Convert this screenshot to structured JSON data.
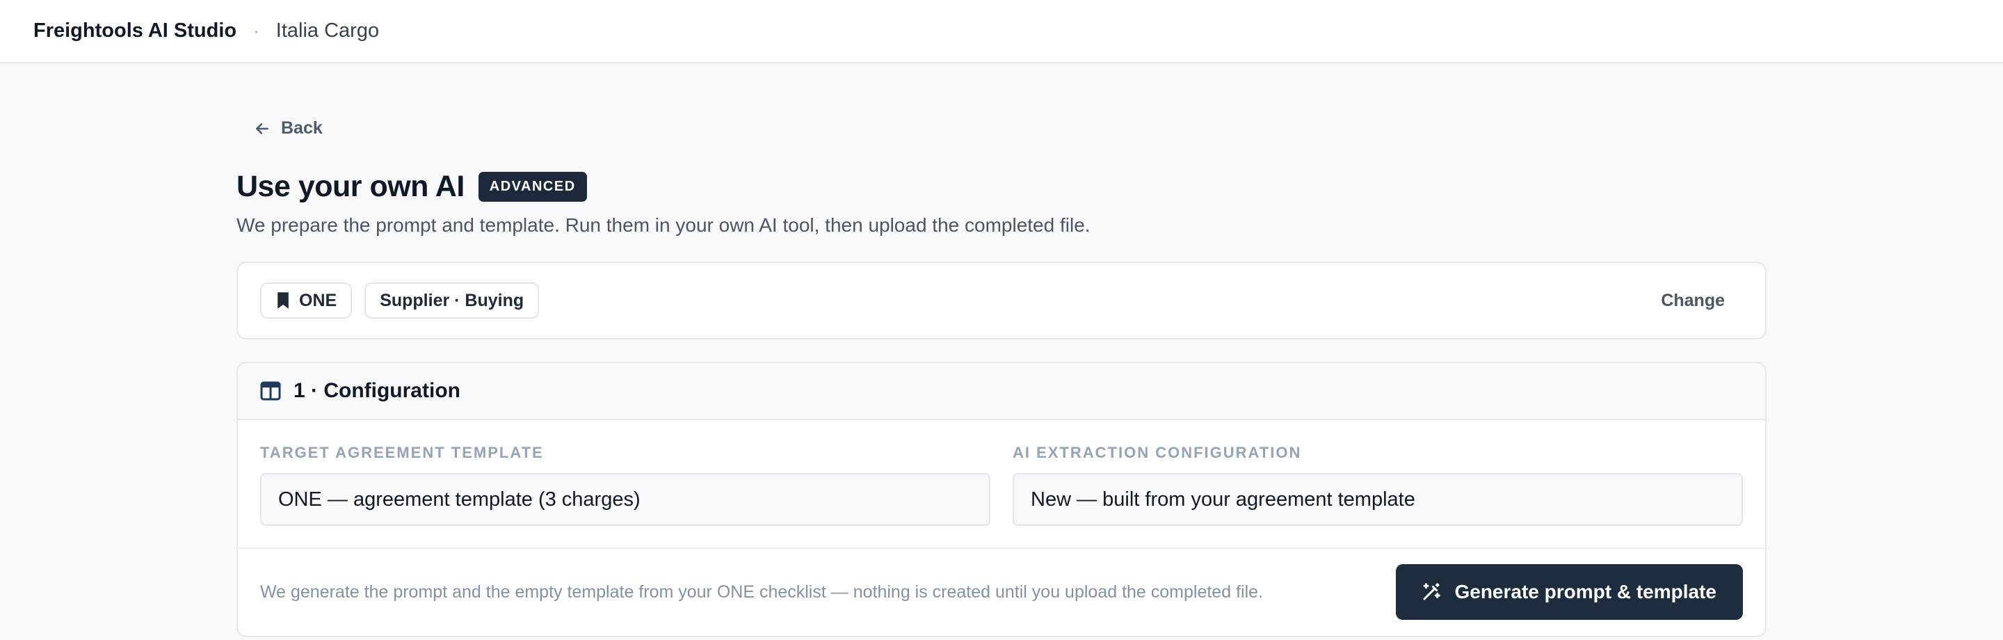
{
  "header": {
    "brand": "Freightools AI Studio",
    "separator": "·",
    "org": "Italia Cargo"
  },
  "nav": {
    "back_label": "Back",
    "back_icon": "arrow-left-icon"
  },
  "page": {
    "title": "Use your own AI",
    "badge": "ADVANCED",
    "subtitle": "We prepare the prompt and template. Run them in your own AI tool, then upload the completed file."
  },
  "selection": {
    "carrier_chip": "ONE",
    "carrier_icon": "bookmark-icon",
    "role_chip": "Supplier · Buying",
    "change_label": "Change"
  },
  "config": {
    "title": "1 · Configuration",
    "icon": "layout-columns-icon",
    "template_label": "TARGET AGREEMENT TEMPLATE",
    "template_value": "ONE — agreement template (3 charges)",
    "extraction_label": "AI EXTRACTION CONFIGURATION",
    "extraction_value": "New — built from your agreement template",
    "footnote": "We generate the prompt and the empty template from your ONE checklist — nothing is created until you upload the completed file.",
    "generate_label": "Generate prompt & template",
    "generate_icon": "magic-wand-icon"
  },
  "colors": {
    "badge_bg": "#1e293b",
    "primary_button": "#1e2d3d",
    "page_bg": "#f8f9fb"
  }
}
